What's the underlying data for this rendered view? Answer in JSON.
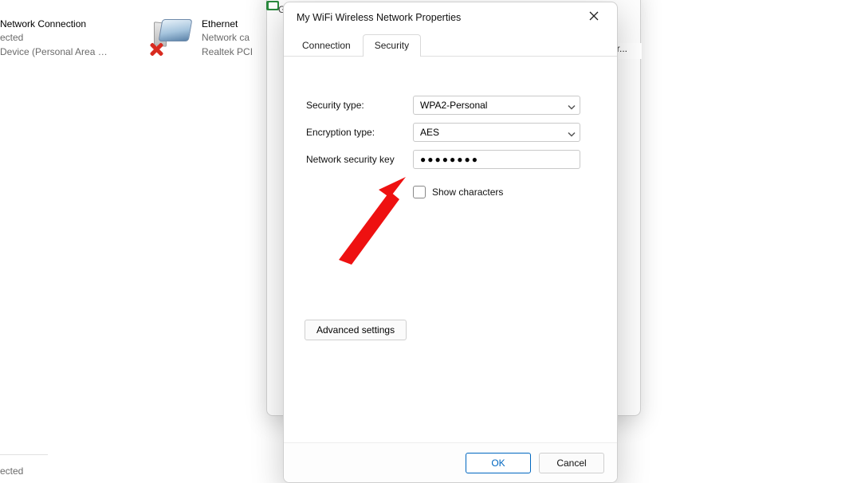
{
  "background": {
    "bluetooth_item": {
      "title_fragment": "Network Connection",
      "status_fragment": "ected",
      "device_fragment": "Device (Personal Area …"
    },
    "ethernet_item": {
      "title": "Ethernet",
      "line2": "Network ca",
      "line3": "Realtek PCI"
    },
    "under_window_char": "G",
    "truncated_right": "ir...",
    "bottom_fragment": "ected"
  },
  "dialog": {
    "title": "My WiFi Wireless Network Properties",
    "tabs": {
      "connection": "Connection",
      "security": "Security"
    },
    "fields": {
      "security_type_label": "Security type:",
      "security_type_value": "WPA2-Personal",
      "encryption_type_label": "Encryption type:",
      "encryption_type_value": "AES",
      "key_label": "Network security key",
      "key_value_masked": "●●●●●●●●",
      "show_characters_label": "Show characters",
      "show_characters_checked": false
    },
    "advanced_button": "Advanced settings",
    "footer": {
      "ok": "OK",
      "cancel": "Cancel"
    }
  }
}
